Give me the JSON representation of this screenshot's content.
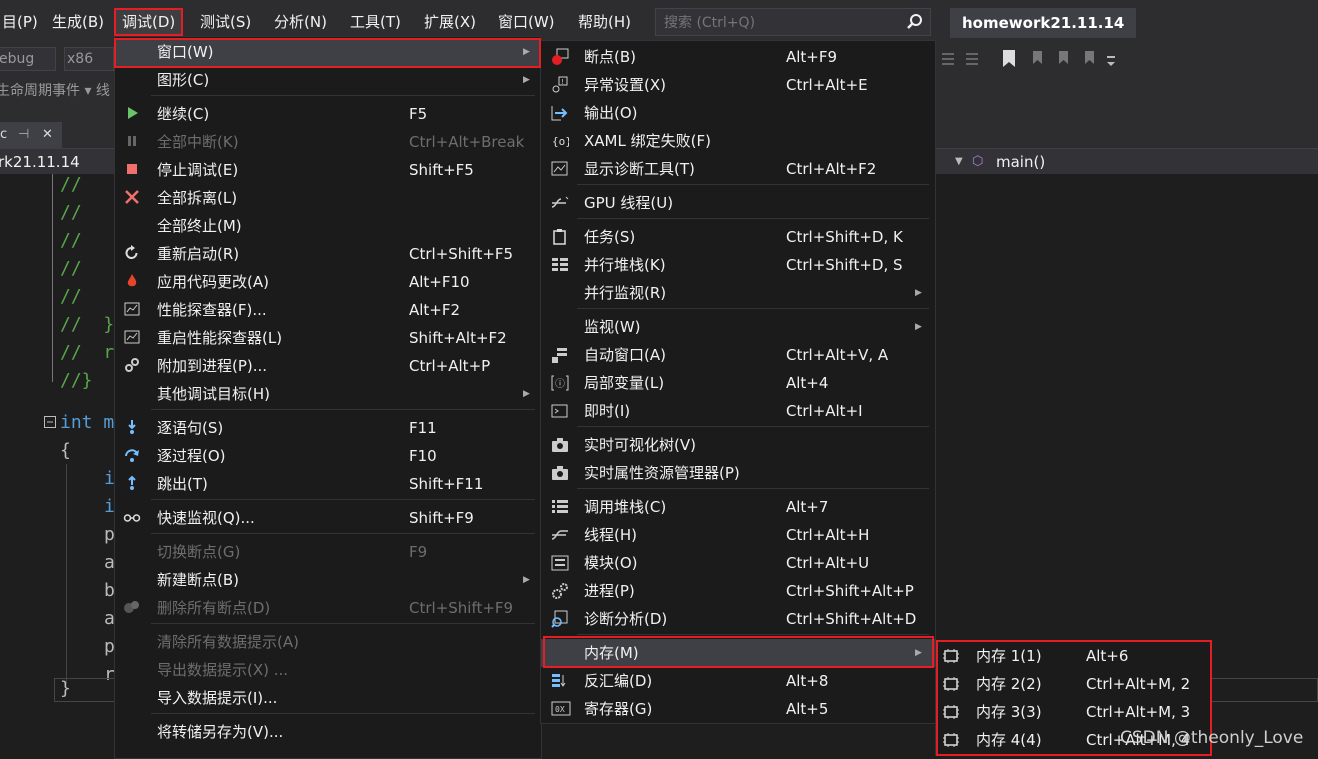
{
  "menubar": {
    "items": [
      "目(P)",
      "生成(B)",
      "调试(D)",
      "测试(S)",
      "分析(N)",
      "工具(T)",
      "扩展(X)",
      "窗口(W)",
      "帮助(H)"
    ],
    "search_placeholder": "搜索 (Ctrl+Q)",
    "project_title": "homework21.11.14"
  },
  "toolbar": {
    "config": "ebug",
    "platform": "x86"
  },
  "navbar": {
    "text": "生命周期事件 ▾  线"
  },
  "tab": {
    "label": "c",
    "pin": "⊣",
    "close": "✕"
  },
  "breadcrumb": {
    "project": "rk21.11.14",
    "function": "main()"
  },
  "editor": {
    "lines": [
      "//   {",
      "//",
      "//",
      "//",
      "//",
      "//  }",
      "//  r",
      "//}",
      "int m",
      "{",
      "i",
      "i",
      "p",
      "a",
      "b",
      "a",
      "p",
      "r",
      "}"
    ]
  },
  "debug_menu": {
    "items": [
      {
        "label": "窗口(W)",
        "shortcut": "",
        "submenu": true,
        "icon": "",
        "disabled": false
      },
      {
        "label": "图形(C)",
        "shortcut": "",
        "submenu": true,
        "icon": "",
        "disabled": false
      },
      {
        "label": "继续(C)",
        "shortcut": "F5",
        "submenu": false,
        "icon": "continue-icon",
        "disabled": false
      },
      {
        "label": "全部中断(K)",
        "shortcut": "Ctrl+Alt+Break",
        "submenu": false,
        "icon": "pause-icon",
        "disabled": true
      },
      {
        "label": "停止调试(E)",
        "shortcut": "Shift+F5",
        "submenu": false,
        "icon": "stop-icon",
        "disabled": false
      },
      {
        "label": "全部拆离(L)",
        "shortcut": "",
        "submenu": false,
        "icon": "detach-icon",
        "disabled": false
      },
      {
        "label": "全部终止(M)",
        "shortcut": "",
        "submenu": false,
        "icon": "",
        "disabled": false
      },
      {
        "label": "重新启动(R)",
        "shortcut": "Ctrl+Shift+F5",
        "submenu": false,
        "icon": "restart-icon",
        "disabled": false
      },
      {
        "label": "应用代码更改(A)",
        "shortcut": "Alt+F10",
        "submenu": false,
        "icon": "hot-reload-icon",
        "disabled": false
      },
      {
        "label": "性能探查器(F)...",
        "shortcut": "Alt+F2",
        "submenu": false,
        "icon": "profiler-icon",
        "disabled": false
      },
      {
        "label": "重启性能探查器(L)",
        "shortcut": "Shift+Alt+F2",
        "submenu": false,
        "icon": "profiler-icon",
        "disabled": false
      },
      {
        "label": "附加到进程(P)...",
        "shortcut": "Ctrl+Alt+P",
        "submenu": false,
        "icon": "attach-icon",
        "disabled": false
      },
      {
        "label": "其他调试目标(H)",
        "shortcut": "",
        "submenu": true,
        "icon": "",
        "disabled": false
      },
      {
        "label": "逐语句(S)",
        "shortcut": "F11",
        "submenu": false,
        "icon": "step-into-icon",
        "disabled": false
      },
      {
        "label": "逐过程(O)",
        "shortcut": "F10",
        "submenu": false,
        "icon": "step-over-icon",
        "disabled": false
      },
      {
        "label": "跳出(T)",
        "shortcut": "Shift+F11",
        "submenu": false,
        "icon": "step-out-icon",
        "disabled": false
      },
      {
        "label": "快速监视(Q)...",
        "shortcut": "Shift+F9",
        "submenu": false,
        "icon": "quickwatch-icon",
        "disabled": false
      },
      {
        "label": "切换断点(G)",
        "shortcut": "F9",
        "submenu": false,
        "icon": "",
        "disabled": true
      },
      {
        "label": "新建断点(B)",
        "shortcut": "",
        "submenu": true,
        "icon": "",
        "disabled": false
      },
      {
        "label": "删除所有断点(D)",
        "shortcut": "Ctrl+Shift+F9",
        "submenu": false,
        "icon": "delete-breakpoints-icon",
        "disabled": true
      },
      {
        "label": "清除所有数据提示(A)",
        "shortcut": "",
        "submenu": false,
        "icon": "",
        "disabled": true
      },
      {
        "label": "导出数据提示(X) ...",
        "shortcut": "",
        "submenu": false,
        "icon": "",
        "disabled": true
      },
      {
        "label": "导入数据提示(I)...",
        "shortcut": "",
        "submenu": false,
        "icon": "",
        "disabled": false
      },
      {
        "label": "将转储另存为(V)...",
        "shortcut": "",
        "submenu": false,
        "icon": "",
        "disabled": false
      }
    ]
  },
  "window_menu": {
    "items": [
      {
        "label": "断点(B)",
        "shortcut": "Alt+F9",
        "submenu": false,
        "icon": "breakpoints-icon"
      },
      {
        "label": "异常设置(X)",
        "shortcut": "Ctrl+Alt+E",
        "submenu": false,
        "icon": "exception-settings-icon"
      },
      {
        "label": "输出(O)",
        "shortcut": "",
        "submenu": false,
        "icon": "output-icon"
      },
      {
        "label": "XAML 绑定失败(F)",
        "shortcut": "",
        "submenu": false,
        "icon": "xaml-binding-icon"
      },
      {
        "label": "显示诊断工具(T)",
        "shortcut": "Ctrl+Alt+F2",
        "submenu": false,
        "icon": "diagnostic-tools-icon"
      },
      {
        "label": "GPU 线程(U)",
        "shortcut": "",
        "submenu": false,
        "icon": "gpu-threads-icon"
      },
      {
        "label": "任务(S)",
        "shortcut": "Ctrl+Shift+D, K",
        "submenu": false,
        "icon": "tasks-icon"
      },
      {
        "label": "并行堆栈(K)",
        "shortcut": "Ctrl+Shift+D, S",
        "submenu": false,
        "icon": "parallel-stacks-icon"
      },
      {
        "label": "并行监视(R)",
        "shortcut": "",
        "submenu": true,
        "icon": ""
      },
      {
        "label": "监视(W)",
        "shortcut": "",
        "submenu": true,
        "icon": ""
      },
      {
        "label": "自动窗口(A)",
        "shortcut": "Ctrl+Alt+V, A",
        "submenu": false,
        "icon": "autos-icon"
      },
      {
        "label": "局部变量(L)",
        "shortcut": "Alt+4",
        "submenu": false,
        "icon": "locals-icon"
      },
      {
        "label": "即时(I)",
        "shortcut": "Ctrl+Alt+I",
        "submenu": false,
        "icon": "immediate-icon"
      },
      {
        "label": "实时可视化树(V)",
        "shortcut": "",
        "submenu": false,
        "icon": "camera-icon"
      },
      {
        "label": "实时属性资源管理器(P)",
        "shortcut": "",
        "submenu": false,
        "icon": "camera-icon"
      },
      {
        "label": "调用堆栈(C)",
        "shortcut": "Alt+7",
        "submenu": false,
        "icon": "call-stack-icon"
      },
      {
        "label": "线程(H)",
        "shortcut": "Ctrl+Alt+H",
        "submenu": false,
        "icon": "threads-icon"
      },
      {
        "label": "模块(O)",
        "shortcut": "Ctrl+Alt+U",
        "submenu": false,
        "icon": "modules-icon"
      },
      {
        "label": "进程(P)",
        "shortcut": "Ctrl+Shift+Alt+P",
        "submenu": false,
        "icon": "processes-icon"
      },
      {
        "label": "诊断分析(D)",
        "shortcut": "Ctrl+Shift+Alt+D",
        "submenu": false,
        "icon": "diagnostic-analysis-icon"
      },
      {
        "label": "内存(M)",
        "shortcut": "",
        "submenu": true,
        "icon": ""
      },
      {
        "label": "反汇编(D)",
        "shortcut": "Alt+8",
        "submenu": false,
        "icon": "disassembly-icon"
      },
      {
        "label": "寄存器(G)",
        "shortcut": "Alt+5",
        "submenu": false,
        "icon": "registers-icon"
      }
    ]
  },
  "memory_menu": {
    "items": [
      {
        "label": "内存 1(1)",
        "shortcut": "Alt+6"
      },
      {
        "label": "内存 2(2)",
        "shortcut": "Ctrl+Alt+M, 2"
      },
      {
        "label": "内存 3(3)",
        "shortcut": "Ctrl+Alt+M, 3"
      },
      {
        "label": "内存 4(4)",
        "shortcut": "Ctrl+Alt+M, 4"
      }
    ]
  },
  "watermark": "CSDN @theonly_Love",
  "colors": {
    "accent_red": "#e51e24",
    "menu_bg": "#1b1b1c",
    "highlight": "#3f3f46",
    "comment_green": "#57a64a",
    "keyword_blue": "#569cd6"
  }
}
